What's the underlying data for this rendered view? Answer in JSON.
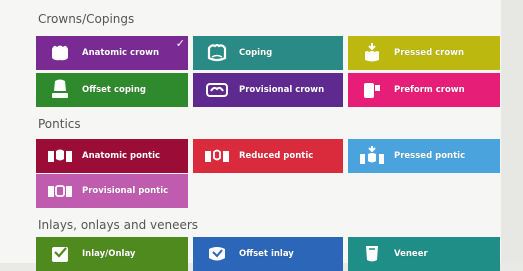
{
  "sections": [
    {
      "title": "Crowns/Copings"
    },
    {
      "title": "Pontics"
    },
    {
      "title": "Inlays, onlays and veneers"
    }
  ],
  "tiles": {
    "anatomic_crown": {
      "label": "Anatomic crown",
      "color": "#7a2a93",
      "icon": "anatomic-crown-icon",
      "selected": true
    },
    "coping": {
      "label": "Coping",
      "color": "#2a8a86",
      "icon": "coping-icon"
    },
    "pressed_crown": {
      "label": "Pressed crown",
      "color": "#bcb80f",
      "icon": "pressed-crown-icon"
    },
    "offset_coping": {
      "label": "Offset coping",
      "color": "#2f8a2e",
      "icon": "offset-coping-icon"
    },
    "provisional_crown": {
      "label": "Provisional crown",
      "color": "#5e2a8f",
      "icon": "provisional-crown-icon"
    },
    "preform_crown": {
      "label": "Preform crown",
      "color": "#e61e78",
      "icon": "preform-crown-icon"
    },
    "anatomic_pontic": {
      "label": "Anatomic pontic",
      "color": "#9b0d36",
      "icon": "anatomic-pontic-icon"
    },
    "reduced_pontic": {
      "label": "Reduced pontic",
      "color": "#d92b3c",
      "icon": "reduced-pontic-icon"
    },
    "pressed_pontic": {
      "label": "Pressed pontic",
      "color": "#4aa3dc",
      "icon": "pressed-pontic-icon"
    },
    "provisional_pontic": {
      "label": "Provisional pontic",
      "color": "#c05cb0",
      "icon": "provisional-pontic-icon"
    },
    "inlay_onlay": {
      "label": "Inlay/Onlay",
      "color": "#4f8a1e",
      "icon": "inlay-onlay-icon"
    },
    "offset_inlay": {
      "label": "Offset inlay",
      "color": "#2c66b8",
      "icon": "offset-inlay-icon"
    },
    "veneer": {
      "label": "Veneer",
      "color": "#1f8e86",
      "icon": "veneer-icon"
    }
  }
}
